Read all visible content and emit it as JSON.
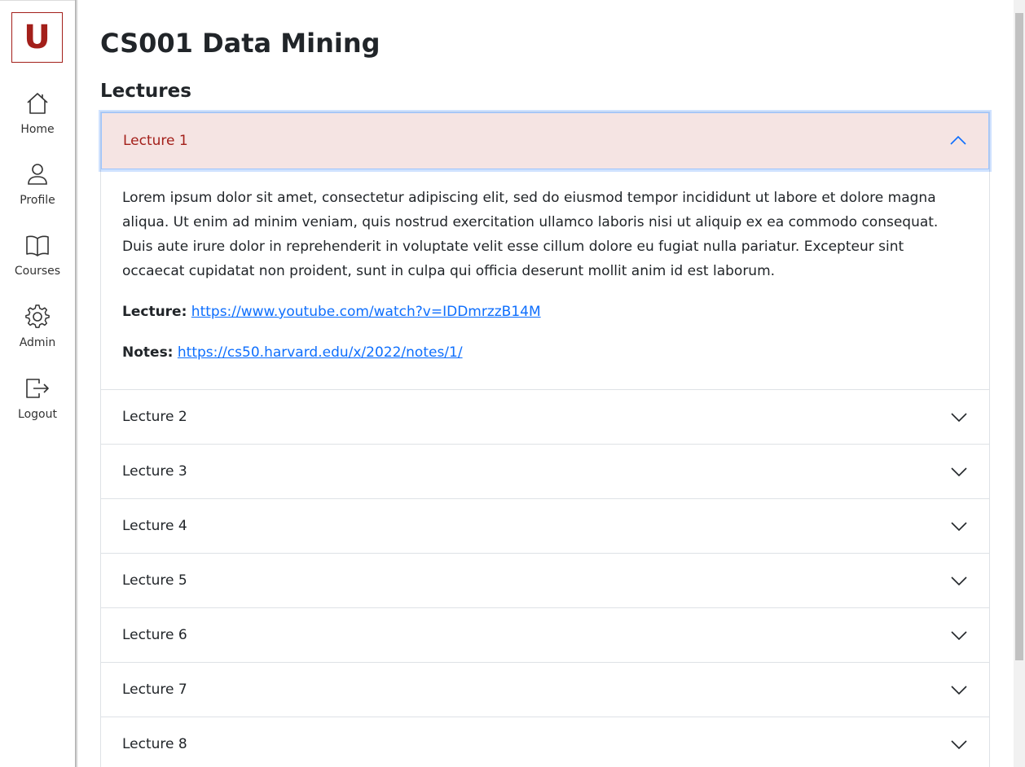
{
  "sidebar": {
    "logo": "U",
    "items": [
      {
        "label": "Home",
        "icon": "home-icon"
      },
      {
        "label": "Profile",
        "icon": "person-icon"
      },
      {
        "label": "Courses",
        "icon": "book-icon"
      },
      {
        "label": "Admin",
        "icon": "gear-icon"
      },
      {
        "label": "Logout",
        "icon": "logout-icon"
      }
    ]
  },
  "main": {
    "title": "CS001 Data Mining",
    "section": "Lectures",
    "lectures": [
      {
        "label": "Lecture 1",
        "description": "Lorem ipsum dolor sit amet, consectetur adipiscing elit, sed do eiusmod tempor incididunt ut labore et dolore magna aliqua. Ut enim ad minim veniam, quis nostrud exercitation ullamco laboris nisi ut aliquip ex ea commodo consequat. Duis aute irure dolor in reprehenderit in voluptate velit esse cillum dolore eu fugiat nulla pariatur. Excepteur sint occaecat cupidatat non proident, sunt in culpa qui officia deserunt mollit anim id est laborum.",
        "lecture_label": "Lecture:",
        "lecture_link": "https://www.youtube.com/watch?v=IDDmrzzB14M",
        "notes_label": "Notes:",
        "notes_link": "https://cs50.harvard.edu/x/2022/notes/1/"
      },
      {
        "label": "Lecture 2"
      },
      {
        "label": "Lecture 3"
      },
      {
        "label": "Lecture 4"
      },
      {
        "label": "Lecture 5"
      },
      {
        "label": "Lecture 6"
      },
      {
        "label": "Lecture 7"
      },
      {
        "label": "Lecture 8"
      }
    ]
  },
  "colors": {
    "brand": "#a31f1a",
    "open_header_bg": "#f5e4e3",
    "link": "#0d6efd"
  }
}
